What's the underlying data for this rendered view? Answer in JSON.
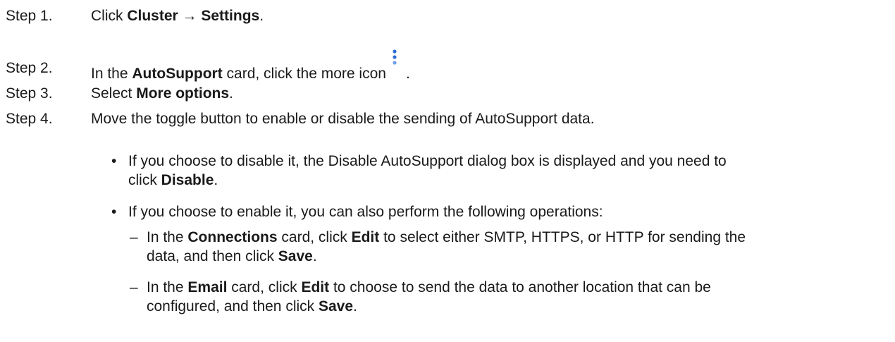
{
  "steps": [
    {
      "label": "Step 1.",
      "parts": [
        "Click ",
        "Cluster → Settings",
        "."
      ]
    },
    {
      "label": "Step 2.",
      "parts": [
        "In the ",
        "AutoSupport",
        " card, click the more icon",
        "."
      ]
    },
    {
      "label": "Step 3.",
      "parts": [
        "Select ",
        "More options",
        "."
      ]
    },
    {
      "label": "Step 4.",
      "text": "Move the toggle button to enable or disable the sending of AutoSupport data."
    }
  ],
  "more_icon": {
    "name": "more-vertical-icon",
    "color": "#2f6fd6"
  },
  "bullets": [
    {
      "mark": "•",
      "line1": "If you choose to disable it, the Disable AutoSupport dialog box is displayed and you need to",
      "line2_parts": [
        "click ",
        "Disable",
        "."
      ]
    },
    {
      "mark": "•",
      "text": "If you choose to enable it, you can also perform the following operations:"
    }
  ],
  "subitems": [
    {
      "mark": "–",
      "line1_parts": [
        "In the ",
        "Connections",
        " card, click ",
        "Edit",
        " to select either SMTP, HTTPS, or HTTP for sending the"
      ],
      "line2_parts": [
        "data, and then click ",
        "Save",
        "."
      ]
    },
    {
      "mark": "–",
      "line1_parts": [
        "In the ",
        "Email",
        " card, click ",
        "Edit",
        " to choose to send the data to another location that can be"
      ],
      "line2_parts": [
        "configured, and then click ",
        "Save",
        "."
      ]
    }
  ]
}
